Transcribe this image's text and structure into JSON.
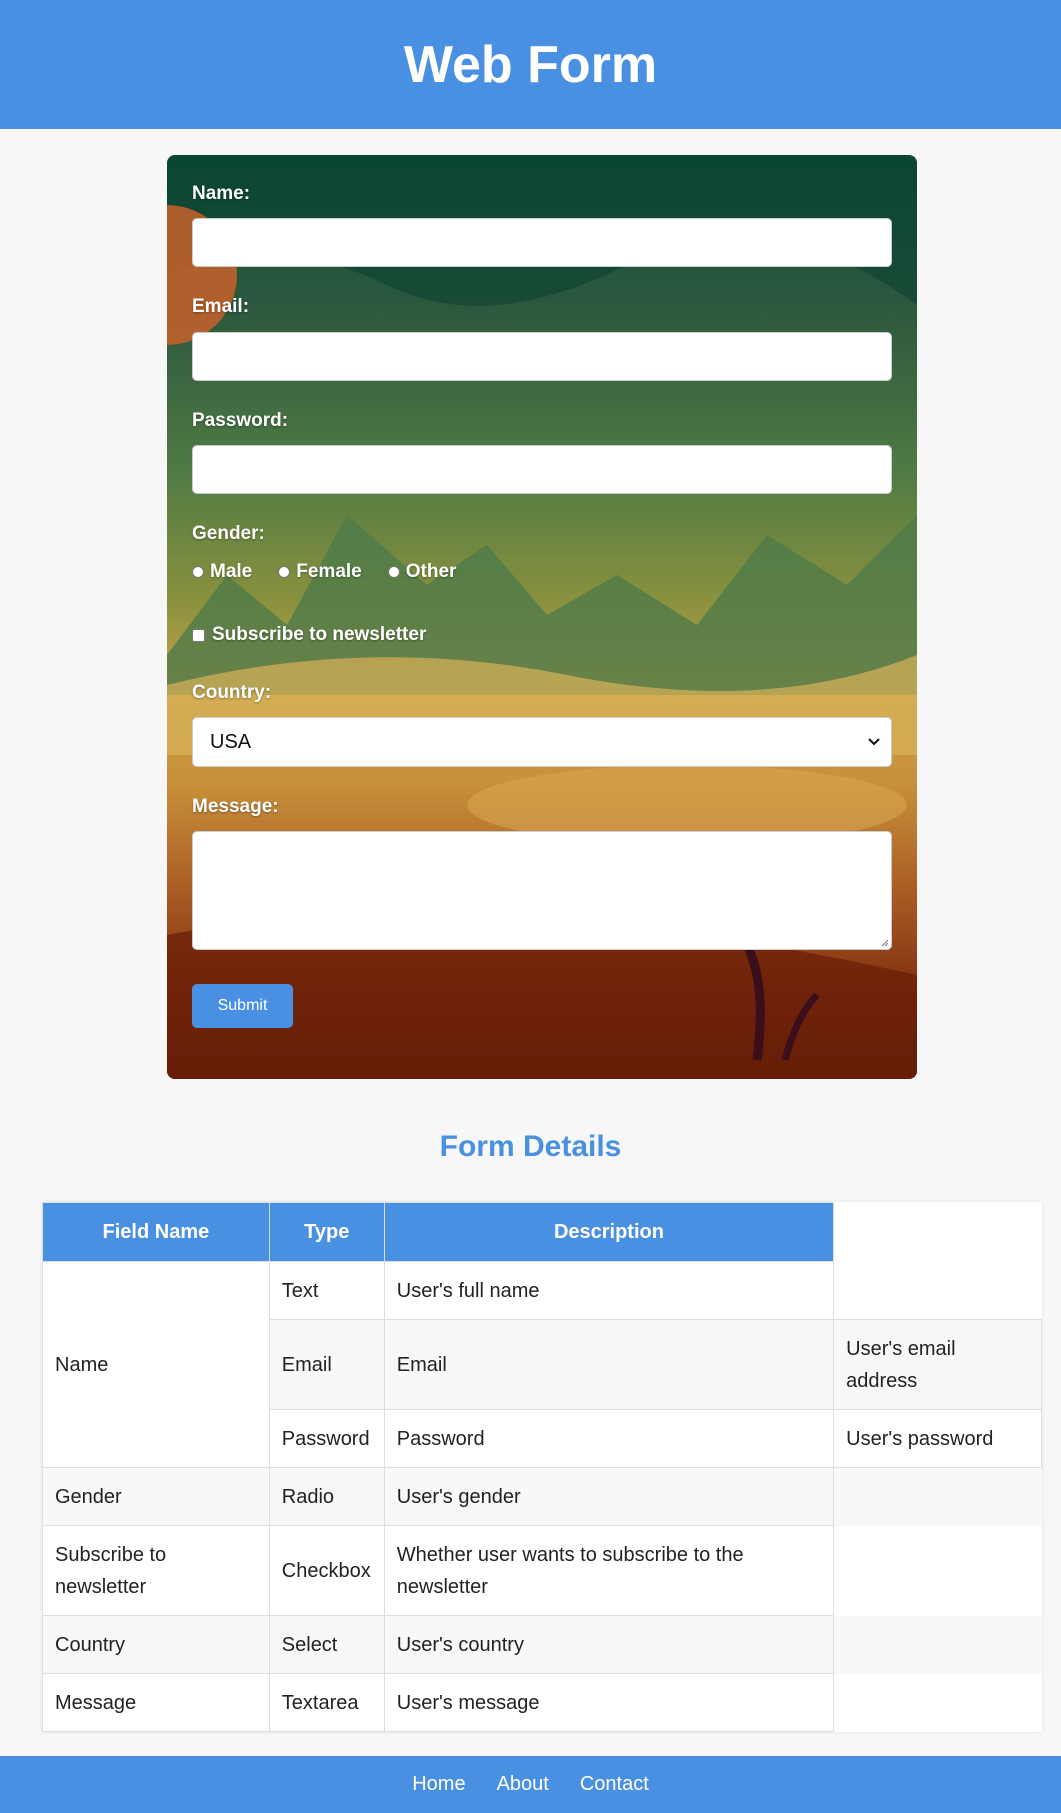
{
  "header": {
    "title": "Web Form"
  },
  "form": {
    "name_label": "Name:",
    "email_label": "Email:",
    "password_label": "Password:",
    "gender_label": "Gender:",
    "gender_options": [
      "Male",
      "Female",
      "Other"
    ],
    "subscribe_label": "Subscribe to newsletter",
    "country_label": "Country:",
    "country_selected": "USA",
    "message_label": "Message:",
    "submit_label": "Submit"
  },
  "details": {
    "title": "Form Details",
    "headers": [
      "Field Name",
      "Type",
      "Description"
    ],
    "rows": {
      "name_group_field": "Name",
      "r1": {
        "type": "Text",
        "desc": "User's full name"
      },
      "r2": {
        "type": "Email",
        "desc": "Email",
        "extra": "User's email address"
      },
      "r3": {
        "type": "Password",
        "desc": "Password",
        "extra": "User's password"
      },
      "r4": {
        "field": "Gender",
        "type": "Radio",
        "desc": "User's gender"
      },
      "r5": {
        "field": "Subscribe to newsletter",
        "type": "Checkbox",
        "desc": "Whether user wants to subscribe to the newsletter"
      },
      "r6": {
        "field": "Country",
        "type": "Select",
        "desc": "User's country"
      },
      "r7": {
        "field": "Message",
        "type": "Textarea",
        "desc": "User's message"
      }
    }
  },
  "footer": {
    "links": [
      "Home",
      "About",
      "Contact"
    ]
  },
  "colors": {
    "accent": "#4a90e2",
    "page_bg": "#f7f7f7"
  }
}
